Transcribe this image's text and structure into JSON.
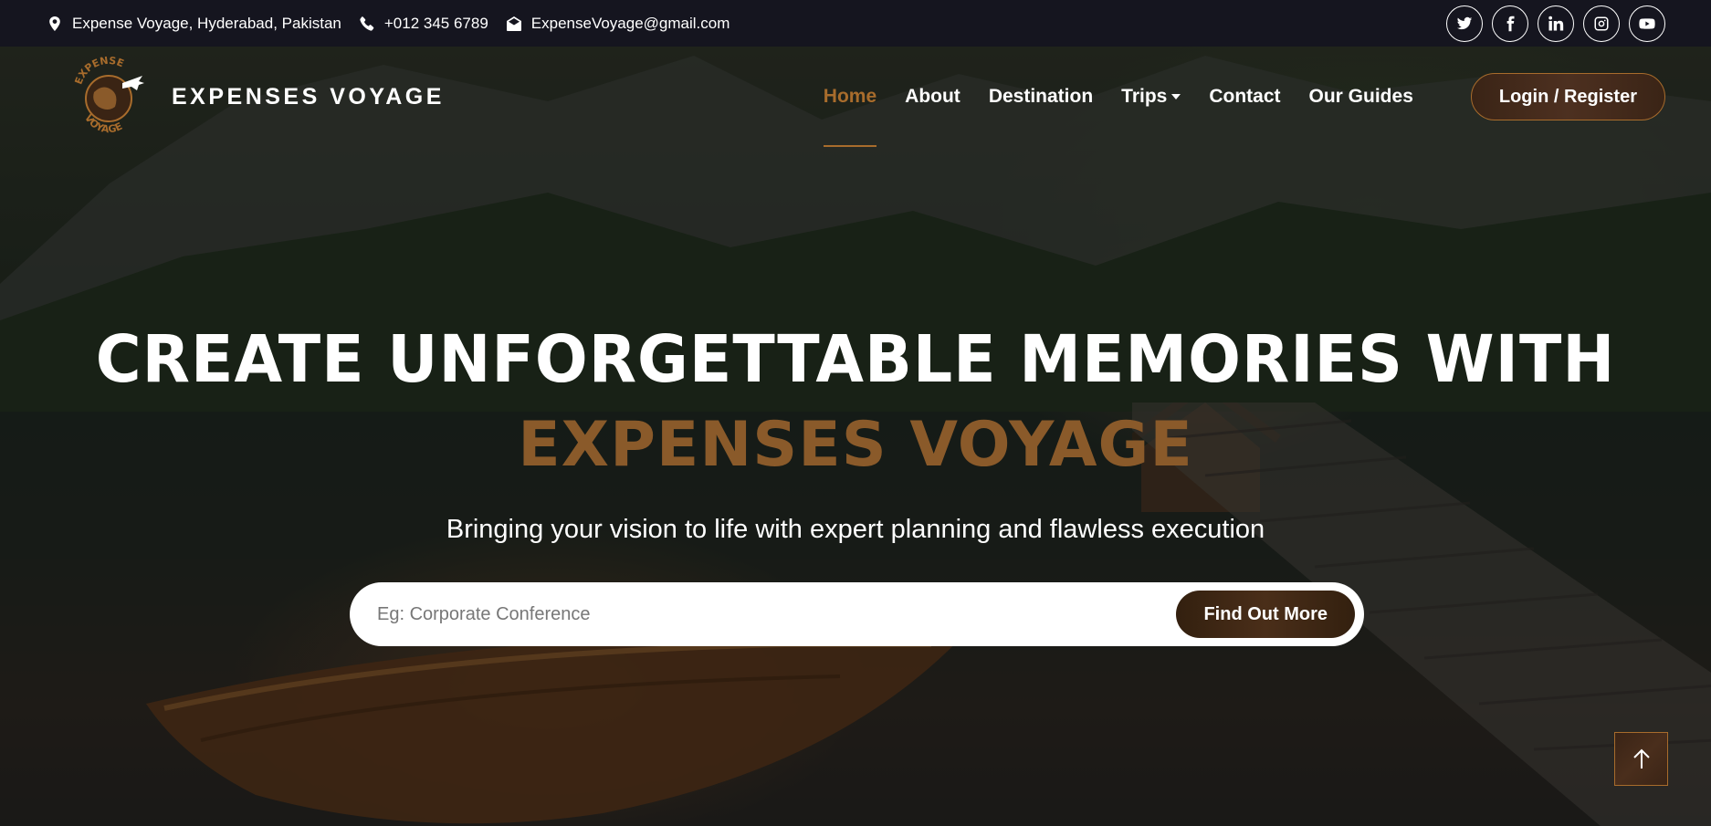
{
  "topbar": {
    "address": "Expense Voyage, Hyderabad, Pakistan",
    "phone": "+012 345 6789",
    "email": "ExpenseVoyage@gmail.com",
    "socials": [
      "twitter-icon",
      "facebook-icon",
      "linkedin-icon",
      "instagram-icon",
      "youtube-icon"
    ]
  },
  "logo": {
    "top_text": "EXPENSE",
    "bottom_text": "VOYAGE"
  },
  "brand": "EXPENSES VOYAGE",
  "nav": {
    "items": [
      "Home",
      "About",
      "Destination",
      "Trips",
      "Contact",
      "Our Guides"
    ],
    "active": "Home",
    "login_label": "Login / Register"
  },
  "hero": {
    "headline": "Create Unforgettable Memories With",
    "headline_highlight": "Expenses Voyage",
    "subtitle": "Bringing your vision to life with expert planning and flawless execution",
    "search_placeholder": "Eg: Corporate Conference",
    "search_value": "",
    "button_label": "Find Out More"
  },
  "colors": {
    "accent": "#a86c2c",
    "highlight": "#8a5a2a",
    "topbar_bg": "#15151f",
    "button_bg": "#3a2416"
  }
}
